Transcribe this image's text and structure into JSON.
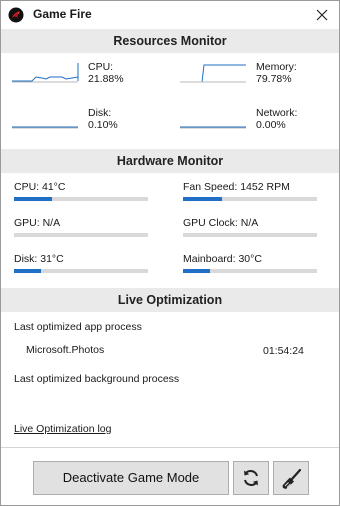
{
  "window": {
    "title": "Game Fire"
  },
  "resources": {
    "header": "Resources Monitor",
    "cpu": {
      "label": "CPU:",
      "value": "21.88%"
    },
    "memory": {
      "label": "Memory:",
      "value": "79.78%"
    },
    "disk": {
      "label": "Disk:",
      "value": "0.10%"
    },
    "network": {
      "label": "Network:",
      "value": "0.00%"
    }
  },
  "hardware": {
    "header": "Hardware Monitor",
    "items": [
      {
        "label": "CPU: 41°C",
        "level": 0.28
      },
      {
        "label": "Fan Speed: 1452 RPM",
        "level": 0.29
      },
      {
        "label": "GPU: N/A",
        "level": 0
      },
      {
        "label": "GPU Clock: N/A",
        "level": 0
      },
      {
        "label": "Disk: 31°C",
        "level": 0.2
      },
      {
        "label": "Mainboard: 30°C",
        "level": 0.2
      }
    ]
  },
  "live": {
    "header": "Live Optimization",
    "app_process_label": "Last optimized app process",
    "app_process_name": "Microsoft.Photos",
    "app_process_time": "01:54:24",
    "background_process_label": "Last optimized background process",
    "log_link": "Live Optimization log"
  },
  "actions": {
    "deactivate_label": "Deactivate Game Mode",
    "refresh_icon": "refresh-icon",
    "clean_icon": "broom-icon"
  },
  "colors": {
    "accent": "#1f6fc6",
    "header_bg": "#eaeaea",
    "logo": "#c0151b"
  }
}
